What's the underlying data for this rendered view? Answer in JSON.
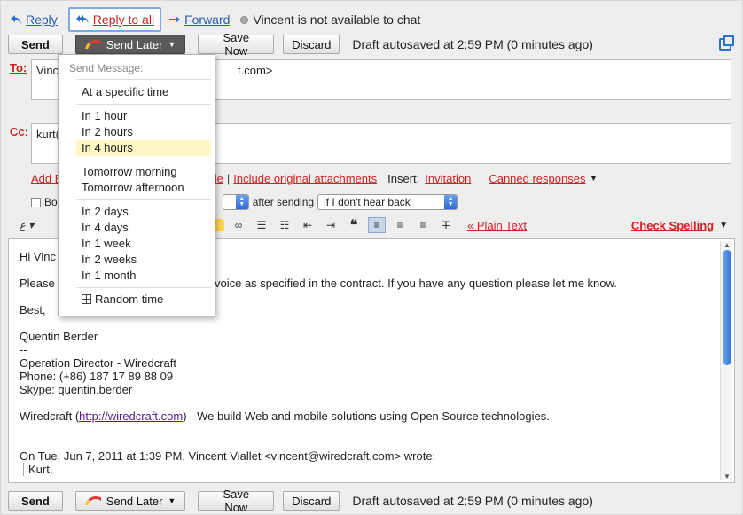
{
  "header": {
    "reply_label": "Reply",
    "reply_all_label": "Reply to all",
    "forward_label": "Forward",
    "chat_status": "Vincent is not available to chat"
  },
  "toolbar": {
    "send_label": "Send",
    "send_later_label": "Send Later",
    "save_now_label": "Save Now",
    "discard_label": "Discard",
    "autosave_text": "Draft autosaved at 2:59 PM (0 minutes ago)"
  },
  "to_field": {
    "label": "To:",
    "value_visible": "Vinc",
    "value_tail": "t.com>"
  },
  "cc_field": {
    "label": "Cc:",
    "value_visible": "kurt("
  },
  "attachments": {
    "add_link": "Add E",
    "file_link": "a file",
    "include_original": "Include original attachments",
    "insert_label": "Insert:",
    "invitation": "Invitation",
    "canned": "Canned responses"
  },
  "options": {
    "checkbox_label": "Bo",
    "after_sending": "after sending",
    "condition_select": "if I don't hear back"
  },
  "format": {
    "plain_text": "« Plain Text",
    "check_spelling": "Check Spelling"
  },
  "body": {
    "greeting": "Hi Vinc",
    "line1_start": "Please",
    "line1_end": "y invoice as specified in the contract. If you have any question please let me know.",
    "signoff": "Best,",
    "name": "Quentin Berder",
    "dashes": "--",
    "title": "Operation Director - Wiredcraft",
    "phone": "Phone: (+86) 187 17 89 88 09",
    "skype": "Skype: quentin.berder",
    "company_prefix": "Wiredcraft (",
    "company_url": "http://wiredcraft.com",
    "company_suffix": ") - We build Web and mobile solutions using Open Source technologies.",
    "quote_header": "On Tue, Jun 7, 2011 at 1:39 PM, Vincent Viallet <vincent@wiredcraft.com> wrote:",
    "quote_line": "Kurt,"
  },
  "dropdown": {
    "header": "Send Message:",
    "items": [
      "At a specific time",
      "In 1 hour",
      "In 2 hours",
      "In 4 hours",
      "Tomorrow morning",
      "Tomorrow afternoon",
      "In 2 days",
      "In 4 days",
      "In 1 week",
      "In 2 weeks",
      "In 1 month",
      "Random time"
    ],
    "highlighted": "In 4 hours"
  },
  "bottom_toolbar": {
    "send_label": "Send",
    "send_later_label": "Send Later",
    "save_now_label": "Save Now",
    "discard_label": "Discard",
    "autosave_text": "Draft autosaved at 2:59 PM (0 minutes ago)"
  },
  "colors": {
    "link_blue": "#2a5db0",
    "link_red": "#cc2222",
    "highlight": "#fff7c4"
  }
}
